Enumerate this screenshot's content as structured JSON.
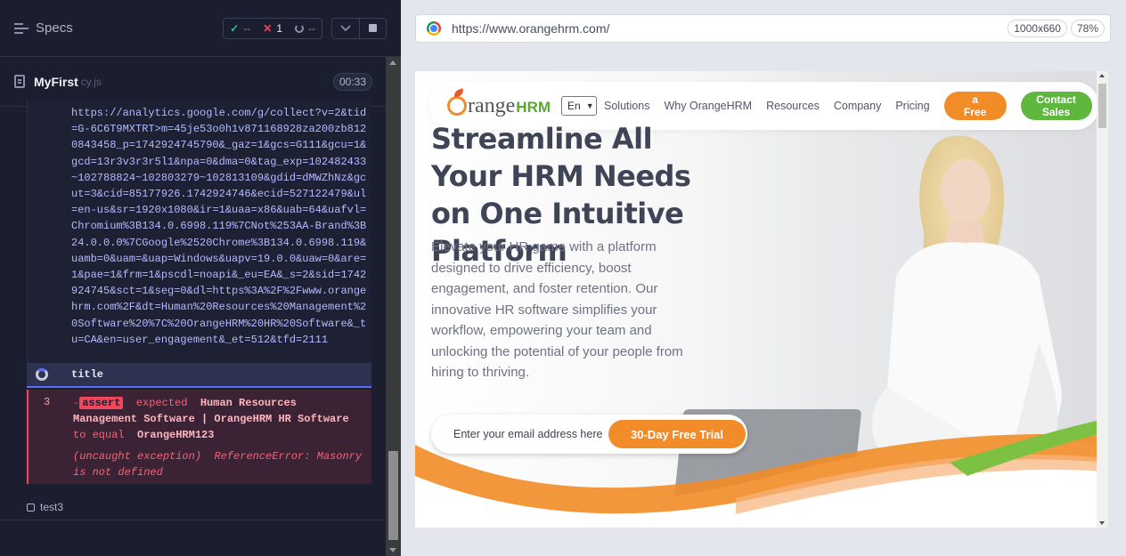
{
  "reporter": {
    "specs_label": "Specs",
    "stats": {
      "passed_icon": "✓",
      "passed": "--",
      "failed_icon": "✕",
      "failed": "1",
      "pending": "--"
    },
    "file": {
      "name": "MyFirst",
      "ext": "cy.js",
      "duration": "00:33"
    },
    "log_url": "https://analytics.google.com/g/collect?v=2&tid=G-6C6T9MXTRT>m=45je53o0h1v871168928za200zb8120843458_p=1742924745790&_gaz=1&gcs=G111&gcu=1&gcd=13r3v3r3r5l1&npa=0&dma=0&tag_exp=102482433~102788824~102803279~102813109&gdid=dMWZhNz&gcut=3&cid=85177926.1742924746&ecid=527122479&ul=en-us&sr=1920x1080&ir=1&uaa=x86&uab=64&uafvl=Chromium%3B134.0.6998.119%7CNot%253AA-Brand%3B24.0.0.0%7CGoogle%2520Chrome%3B134.0.6998.119&uamb=0&uam=&uap=Windows&uapv=19.0.0&uaw=0&are=1&pae=1&frm=1&pscdl=noapi&_eu=EA&_s=2&sid=1742924745&sct=1&seg=0&dl=https%3A%2F%2Fwww.orangehrm.com%2F&dt=Human%20Resources%20Management%20Software%20%7C%20OrangeHRM%20HR%20Software&_tu=CA&en=user_engagement&_et=512&tfd=2111",
    "command_title": "title",
    "error": {
      "number": "3",
      "dash": "-",
      "badge": "assert",
      "expected": "expected",
      "actual": "Human Resources Management Software | OrangeHRM HR Software",
      "to_equal": "to equal",
      "expected_value": "OrangeHRM123",
      "exception_prefix": "(uncaught exception)",
      "exception_msg": "ReferenceError: Masonry is not defined"
    },
    "test3": "test3"
  },
  "aut": {
    "url": "https://www.orangehrm.com/",
    "viewport": "1000x660",
    "zoom": "78%"
  },
  "page": {
    "logo_text": "range",
    "logo_hrm": "HRM",
    "lang": "En",
    "nav": [
      "Solutions",
      "Why OrangeHRM",
      "Resources",
      "Company",
      "Pricing"
    ],
    "btn_free_line1": "a",
    "btn_free_line2": "Free",
    "btn_contact_line1": "Contact",
    "btn_contact_line2": "Sales",
    "headline": "Streamline All Your HRM Needs on One Intuitive Platform",
    "subtext": "Elevate your HR game with a platform designed to drive efficiency, boost engagement, and foster retention. Our innovative HR software simplifies your workflow, empowering your team and unlocking the potential of your people from hiring to thriving.",
    "email_placeholder": "Enter your email address here",
    "trial_button": "30-Day Free Trial"
  },
  "colors": {
    "orange": "#f28c28",
    "green": "#5fb83d",
    "cypress_fail": "#f1465b",
    "cypress_pass": "#3ec09b"
  }
}
